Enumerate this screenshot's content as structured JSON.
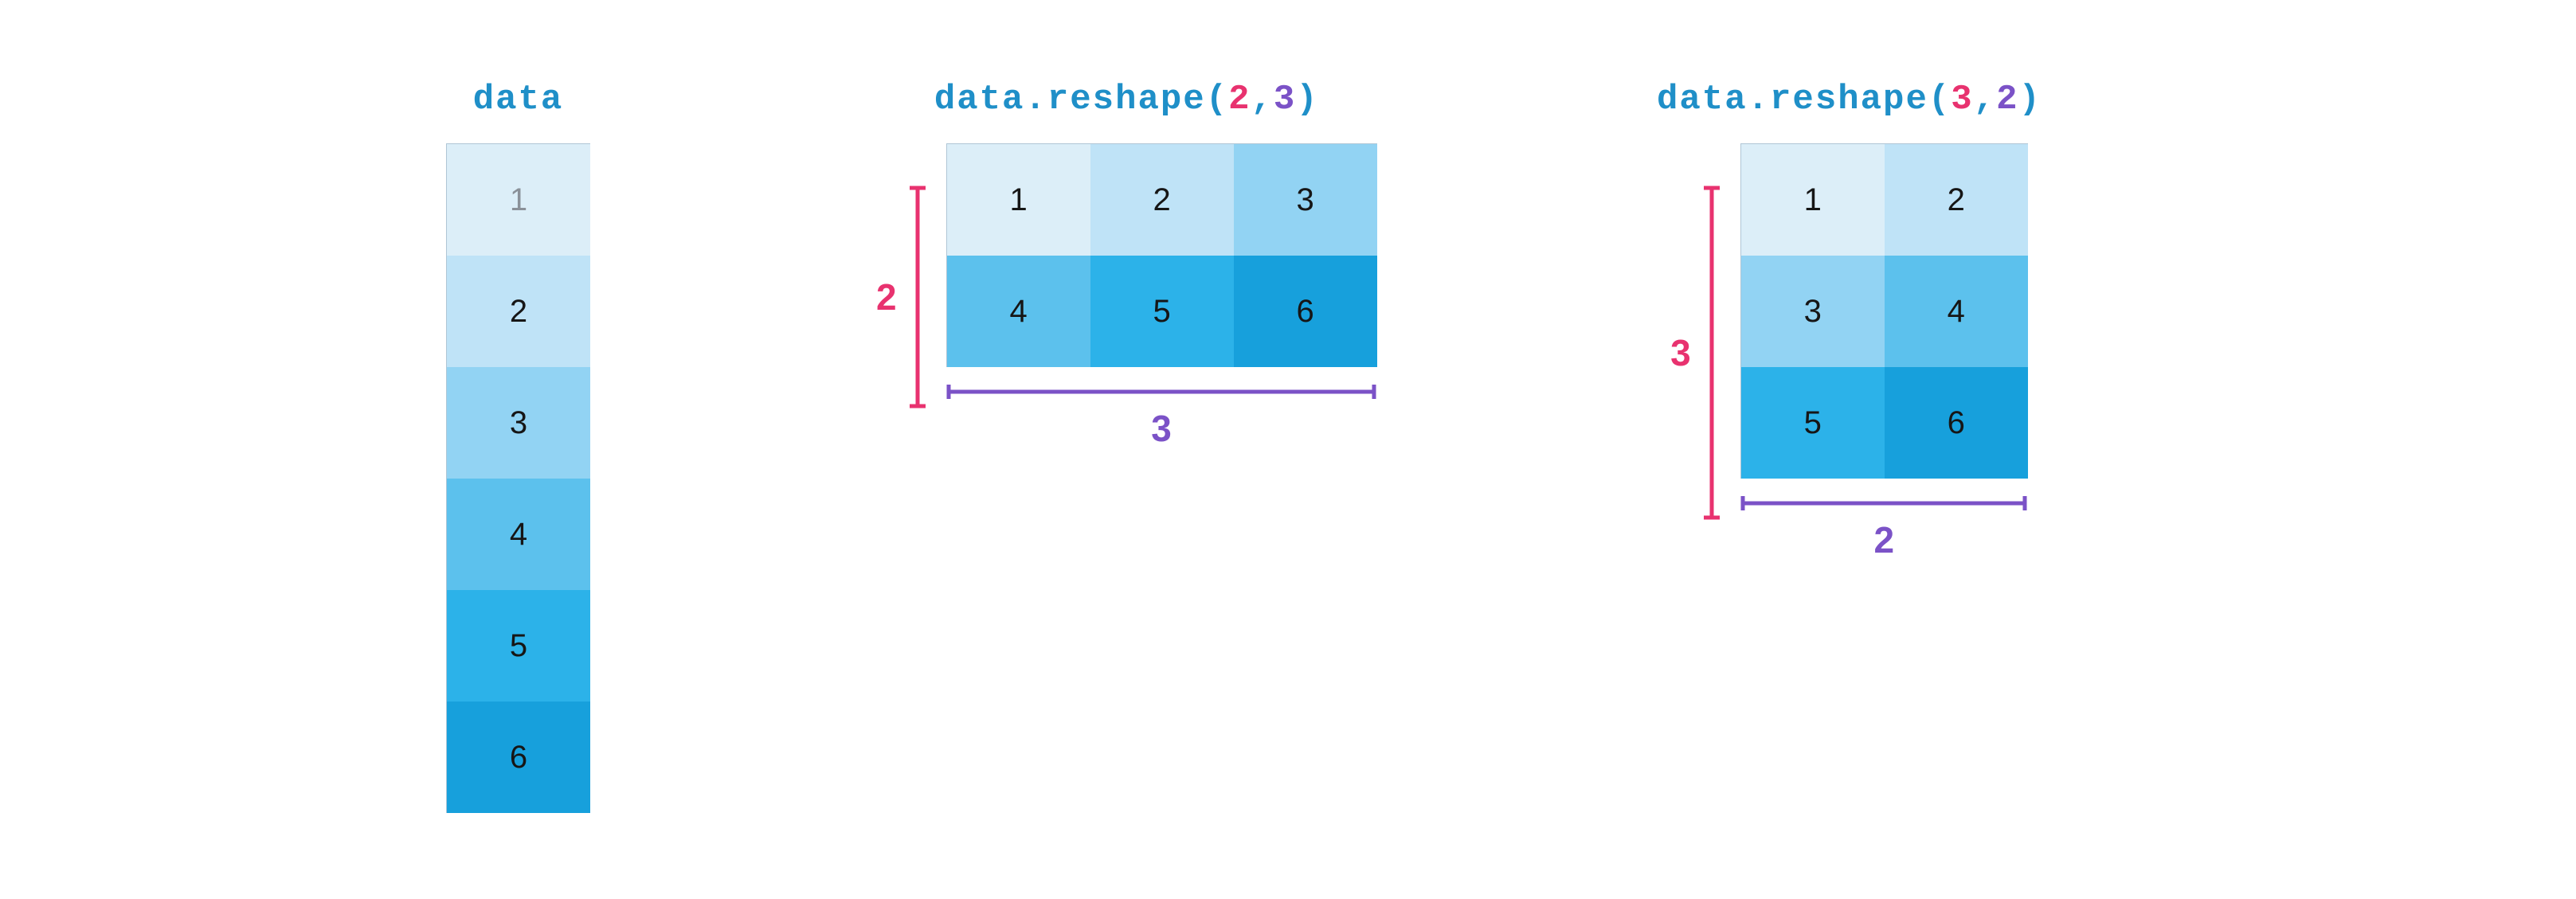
{
  "panels": {
    "source": {
      "title": "data",
      "cells": [
        "1",
        "2",
        "3",
        "4",
        "5",
        "6"
      ]
    },
    "reshape23": {
      "title_pre": "data.reshape(",
      "title_arg1": "2",
      "title_sep": ",",
      "title_arg2": "3",
      "title_post": ")",
      "rows_label": "2",
      "cols_label": "3",
      "cells": [
        "1",
        "2",
        "3",
        "4",
        "5",
        "6"
      ]
    },
    "reshape32": {
      "title_pre": "data.reshape(",
      "title_arg1": "3",
      "title_sep": ",",
      "title_arg2": "2",
      "title_post": ")",
      "rows_label": "3",
      "cols_label": "2",
      "cells": [
        "1",
        "2",
        "3",
        "4",
        "5",
        "6"
      ]
    }
  },
  "colors": {
    "blue_text": "#1f8fc8",
    "pink": "#e8326f",
    "purple": "#7b52c7",
    "shades": [
      "#dceef8",
      "#bfe3f7",
      "#92d3f3",
      "#5cc1ed",
      "#2cb2e9",
      "#17a0dc"
    ]
  },
  "chart_data": {
    "type": "table",
    "description": "NumPy reshape diagram: 1-D array of 6 values reshaped to 2x3 and 3x2",
    "source_array": [
      1,
      2,
      3,
      4,
      5,
      6
    ],
    "reshape_2x3": [
      [
        1,
        2,
        3
      ],
      [
        4,
        5,
        6
      ]
    ],
    "reshape_3x2": [
      [
        1,
        2
      ],
      [
        3,
        4
      ],
      [
        5,
        6
      ]
    ]
  }
}
